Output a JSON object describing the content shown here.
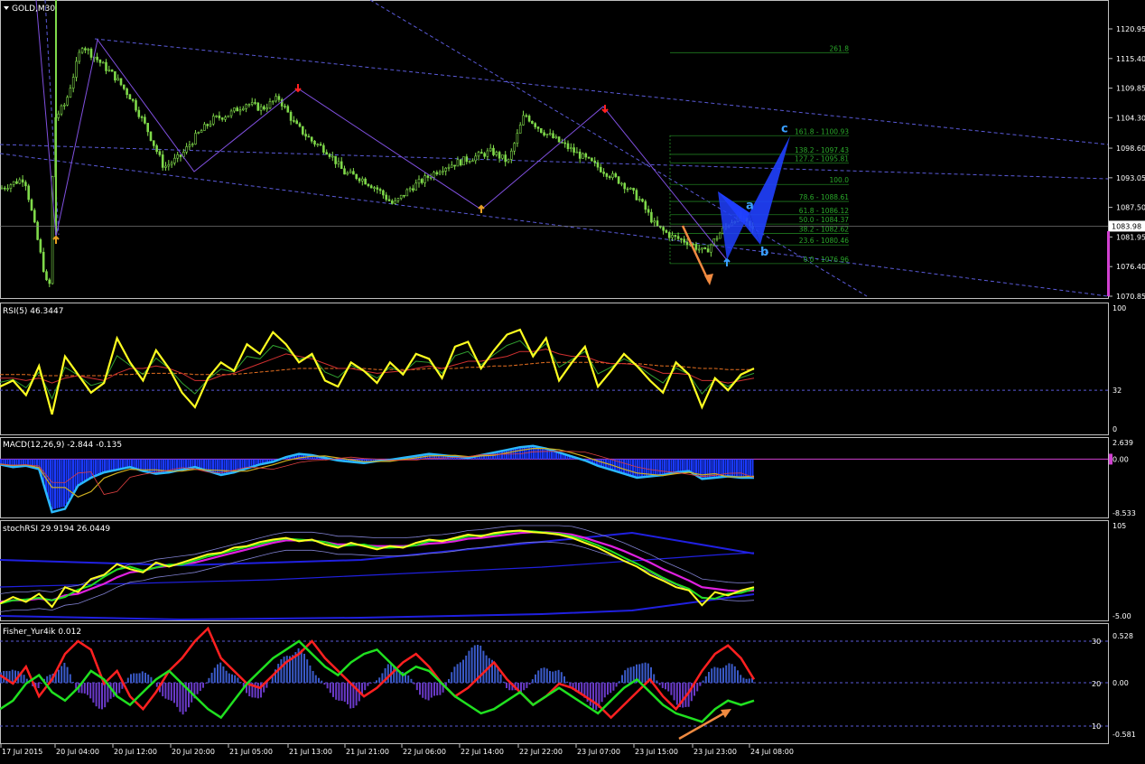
{
  "chart_data": [
    {
      "type": "candlestick",
      "title": "GOLD,M30",
      "ylim": [
        1069,
        1123.5
      ],
      "y_ticks": [
        "1120.95",
        "1115.40",
        "1109.85",
        "1104.30",
        "1098.60",
        "1093.05",
        "1087.50",
        "1081.95",
        "1076.40",
        "1070.85"
      ],
      "current_price": "1083.98",
      "fib_levels": [
        {
          "label": "261.8",
          "value": 1116.5
        },
        {
          "label": "161.8 - 1100.93",
          "value": 1100.93
        },
        {
          "label": "138.2 - 1097.43",
          "value": 1097.43
        },
        {
          "label": "127.2 - 1095.81",
          "value": 1095.81
        },
        {
          "label": "100.0",
          "value": 1091.8
        },
        {
          "label": "78.6 - 1088.61",
          "value": 1088.61
        },
        {
          "label": "61.8 - 1086.12",
          "value": 1086.12
        },
        {
          "label": "50.0 - 1084.37",
          "value": 1084.37
        },
        {
          "label": "38.2 - 1082.62",
          "value": 1082.62
        },
        {
          "label": "23.6 - 1080.46",
          "value": 1080.46
        },
        {
          "label": "0.0 - 1076.96",
          "value": 1076.96
        }
      ],
      "close_path": [
        [
          0,
          1091
        ],
        [
          1.5,
          1093
        ],
        [
          3,
          1071
        ],
        [
          3.3,
          1104
        ],
        [
          4,
          1107
        ],
        [
          5,
          1118
        ],
        [
          6,
          1115
        ],
        [
          7,
          1112
        ],
        [
          8,
          1108
        ],
        [
          9,
          1102
        ],
        [
          10,
          1095
        ],
        [
          11,
          1097
        ],
        [
          12,
          1101
        ],
        [
          13,
          1104
        ],
        [
          14,
          1105
        ],
        [
          15,
          1107
        ],
        [
          16,
          1106
        ],
        [
          17,
          1108
        ],
        [
          18,
          1103
        ],
        [
          19,
          1100
        ],
        [
          20,
          1098
        ],
        [
          21,
          1094
        ],
        [
          22,
          1093
        ],
        [
          23,
          1091
        ],
        [
          24,
          1088
        ],
        [
          25,
          1091
        ],
        [
          26,
          1093
        ],
        [
          27,
          1095
        ],
        [
          28,
          1096
        ],
        [
          29,
          1097
        ],
        [
          30,
          1098
        ],
        [
          31,
          1096
        ],
        [
          32,
          1105
        ],
        [
          33,
          1102
        ],
        [
          34,
          1100
        ],
        [
          35,
          1098
        ],
        [
          36,
          1096
        ],
        [
          37,
          1094
        ],
        [
          38,
          1092
        ],
        [
          39,
          1089
        ],
        [
          40,
          1084
        ],
        [
          41,
          1082
        ],
        [
          42,
          1081
        ],
        [
          43,
          1079
        ],
        [
          44,
          1083
        ],
        [
          45,
          1086
        ],
        [
          46,
          1083
        ]
      ],
      "wave_points": [
        {
          "label": "a",
          "value": 1086.5
        },
        {
          "label": "b",
          "value": 1080.5
        },
        {
          "label": "c",
          "value": 1100.9
        }
      ]
    },
    {
      "type": "line",
      "title": "RSI(5) 46.3447",
      "ylim": [
        0,
        100
      ],
      "y_ticks": [
        "100",
        "32",
        "0"
      ],
      "level": 32,
      "values": [
        35,
        40,
        28,
        52,
        12,
        60,
        45,
        30,
        38,
        75,
        55,
        40,
        65,
        50,
        30,
        18,
        42,
        55,
        48,
        70,
        62,
        80,
        70,
        55,
        62,
        40,
        35,
        55,
        48,
        38,
        55,
        45,
        62,
        58,
        42,
        68,
        72,
        50,
        65,
        78,
        82,
        60,
        75,
        40,
        55,
        68,
        35,
        48,
        62,
        52,
        40,
        30,
        55,
        45,
        18,
        42,
        32,
        45,
        50
      ],
      "signal": [
        42,
        42,
        40,
        42,
        38,
        42,
        44,
        42,
        40,
        46,
        50,
        50,
        52,
        50,
        46,
        40,
        40,
        44,
        46,
        50,
        54,
        58,
        62,
        60,
        58,
        54,
        50,
        50,
        48,
        46,
        47,
        48,
        50,
        52,
        50,
        53,
        56,
        56,
        58,
        60,
        64,
        64,
        66,
        62,
        60,
        60,
        56,
        54,
        54,
        53,
        50,
        46,
        46,
        45,
        40,
        40,
        38,
        40,
        42
      ],
      "signal2": [
        45,
        45,
        45,
        44,
        44,
        44,
        44,
        44,
        44,
        45,
        45,
        46,
        46,
        46,
        46,
        45,
        45,
        45,
        45,
        46,
        47,
        48,
        49,
        50,
        50,
        50,
        50,
        50,
        50,
        49,
        49,
        49,
        49,
        50,
        50,
        50,
        51,
        51,
        52,
        52,
        53,
        54,
        55,
        55,
        55,
        55,
        55,
        54,
        54,
        54,
        53,
        52,
        52,
        51,
        50,
        50,
        49,
        49,
        49
      ]
    },
    {
      "type": "bar",
      "title": "MACD(12,26,9) -2.844 -0.135",
      "ylim": [
        -8.533,
        2.639
      ],
      "y_ticks": [
        "2.639",
        "0.00",
        "-8.533"
      ],
      "values": [
        -0.8,
        -1.2,
        -1.0,
        -1.5,
        -8.0,
        -7.5,
        -4.0,
        -2.8,
        -2.0,
        -1.6,
        -1.2,
        -1.8,
        -2.2,
        -2.0,
        -1.6,
        -1.2,
        -1.8,
        -2.4,
        -2.0,
        -1.4,
        -0.8,
        -0.4,
        0.3,
        0.8,
        0.6,
        0.2,
        -0.2,
        -0.4,
        -0.6,
        -0.3,
        -0.1,
        0.2,
        0.5,
        0.8,
        0.6,
        0.4,
        0.2,
        0.6,
        1.0,
        1.4,
        1.8,
        2.0,
        1.6,
        1.0,
        0.4,
        -0.2,
        -1.0,
        -1.6,
        -2.2,
        -2.8,
        -2.6,
        -2.4,
        -2.0,
        -1.8,
        -3.0,
        -2.8,
        -2.6,
        -2.8,
        -2.8
      ]
    },
    {
      "type": "line",
      "title": "stochRSI 29.9194 26.0449",
      "ylim": [
        -5,
        105
      ],
      "y_ticks": [
        "105",
        "-5.00"
      ],
      "values": [
        10,
        18,
        12,
        22,
        6,
        30,
        24,
        40,
        45,
        58,
        52,
        48,
        60,
        55,
        60,
        65,
        70,
        72,
        78,
        80,
        85,
        88,
        90,
        86,
        88,
        82,
        78,
        84,
        80,
        76,
        80,
        78,
        84,
        88,
        86,
        90,
        94,
        92,
        96,
        98,
        99,
        97,
        96,
        94,
        90,
        84,
        78,
        70,
        62,
        55,
        45,
        38,
        30,
        26,
        8,
        24,
        20,
        26,
        30
      ],
      "signal": [
        12,
        14,
        14,
        16,
        14,
        20,
        22,
        28,
        34,
        42,
        48,
        50,
        54,
        56,
        58,
        60,
        64,
        68,
        72,
        76,
        80,
        84,
        87,
        87,
        87,
        85,
        82,
        82,
        81,
        80,
        80,
        80,
        81,
        83,
        84,
        86,
        89,
        90,
        92,
        94,
        96,
        97,
        97,
        96,
        94,
        90,
        85,
        80,
        74,
        67,
        60,
        52,
        45,
        38,
        30,
        28,
        26,
        25,
        26
      ]
    },
    {
      "type": "bar",
      "title": "Fisher_Yur4ik 0.012",
      "ylim": [
        -0.581,
        0.528
      ],
      "y_ticks": [
        "0.528",
        "0.00",
        "-0.581"
      ],
      "right_labels": [
        "30",
        "20",
        "10"
      ],
      "values": [
        0.08,
        0.18,
        0.04,
        -0.06,
        0.12,
        0.2,
        -0.08,
        -0.2,
        -0.3,
        -0.12,
        0.06,
        0.16,
        -0.04,
        -0.2,
        -0.34,
        -0.2,
        0.06,
        0.22,
        0.08,
        -0.1,
        -0.22,
        0.12,
        0.3,
        0.38,
        0.18,
        -0.06,
        -0.18,
        -0.3,
        -0.12,
        0.06,
        0.2,
        0.14,
        -0.06,
        -0.22,
        -0.1,
        0.16,
        0.36,
        0.42,
        0.22,
        -0.04,
        -0.14,
        0.06,
        0.18,
        0.12,
        -0.04,
        -0.2,
        -0.3,
        -0.1,
        0.1,
        0.24,
        0.18,
        -0.06,
        -0.22,
        -0.3,
        0.04,
        0.16,
        0.22,
        0.1,
        0.02
      ],
      "red_line": [
        22,
        20,
        24,
        17,
        21,
        27,
        30,
        28,
        20,
        23,
        17,
        14,
        18,
        23,
        26,
        30,
        33,
        26,
        23,
        20,
        19,
        22,
        25,
        27,
        30,
        26,
        23,
        20,
        17,
        19,
        22,
        25,
        27,
        24,
        20,
        17,
        19,
        22,
        25,
        21,
        18,
        15,
        17,
        20,
        19,
        17,
        15,
        12,
        15,
        18,
        21,
        17,
        14,
        18,
        23,
        27,
        29,
        26,
        21
      ],
      "green_line": [
        14,
        16,
        20,
        22,
        18,
        16,
        19,
        23,
        21,
        17,
        15,
        18,
        21,
        23,
        20,
        17,
        14,
        12,
        16,
        20,
        23,
        26,
        28,
        30,
        27,
        24,
        22,
        25,
        27,
        28,
        25,
        22,
        24,
        23,
        20,
        17,
        15,
        13,
        14,
        16,
        18,
        15,
        17,
        19,
        17,
        15,
        13,
        16,
        19,
        21,
        18,
        15,
        13,
        12,
        11,
        14,
        16,
        15,
        16
      ]
    }
  ],
  "x_labels": [
    "17 Jul 2015",
    "20 Jul 04:00",
    "20 Jul 12:00",
    "20 Jul 20:00",
    "21 Jul 05:00",
    "21 Jul 13:00",
    "21 Jul 21:00",
    "22 Jul 06:00",
    "22 Jul 14:00",
    "22 Jul 22:00",
    "23 Jul 07:00",
    "23 Jul 15:00",
    "23 Jul 23:00",
    "24 Jul 08:00"
  ]
}
